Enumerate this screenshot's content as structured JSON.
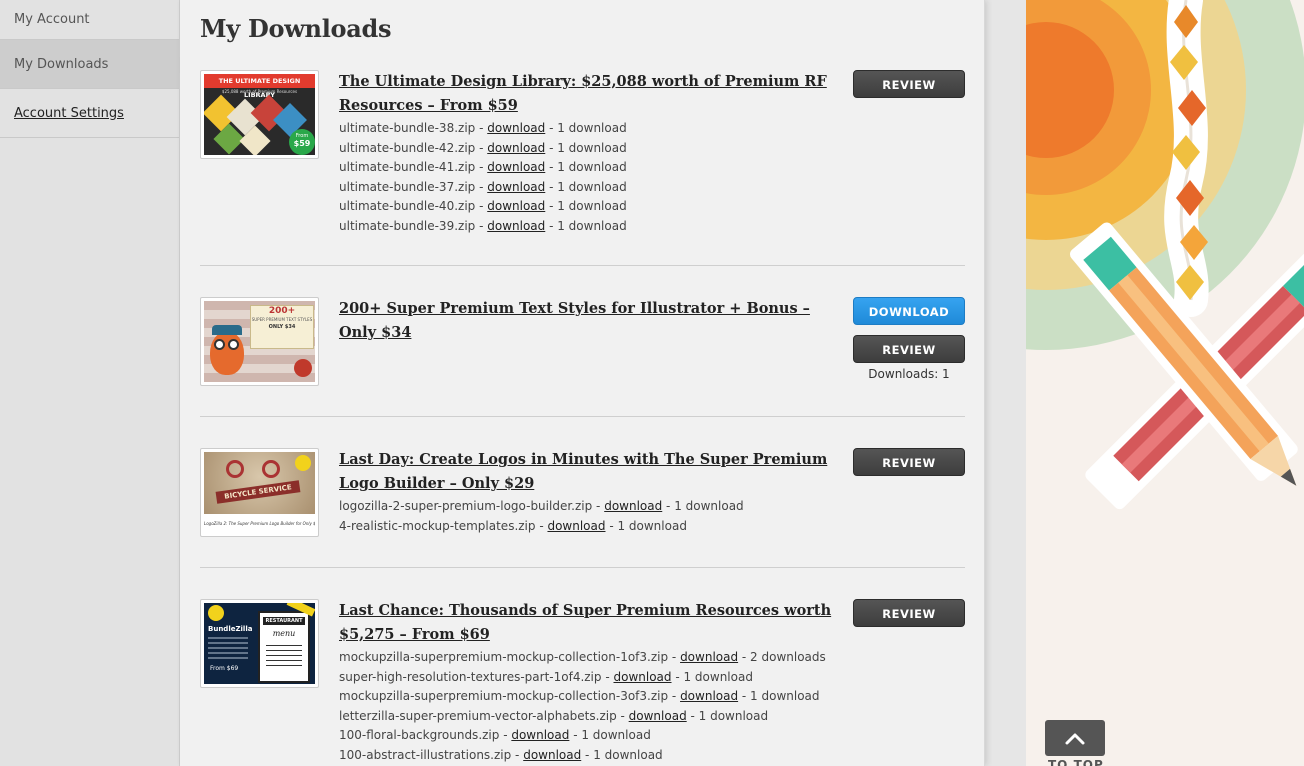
{
  "sidebar": {
    "items": [
      {
        "label": "My Account"
      },
      {
        "label": "My Downloads"
      },
      {
        "label": "Account Settings"
      }
    ]
  },
  "page": {
    "title": "My Downloads"
  },
  "buttons": {
    "review": "REVIEW",
    "download": "DOWNLOAD"
  },
  "download_link": "download",
  "products": [
    {
      "title": "The Ultimate Design Library: $25,088 worth of Premium RF Resources – From $59",
      "files": [
        {
          "name": "ultimate-bundle-38.zip - ",
          "count": " - 1 download"
        },
        {
          "name": "ultimate-bundle-42.zip - ",
          "count": " - 1 download"
        },
        {
          "name": "ultimate-bundle-41.zip - ",
          "count": " - 1 download"
        },
        {
          "name": "ultimate-bundle-37.zip - ",
          "count": " - 1 download"
        },
        {
          "name": "ultimate-bundle-40.zip - ",
          "count": " - 1 download"
        },
        {
          "name": "ultimate-bundle-39.zip - ",
          "count": " - 1 download"
        }
      ],
      "thumb": {
        "line1": "THE ULTIMATE DESIGN LIBRARY",
        "line2": "$25,088 worth of Premium Resources",
        "price1": "From",
        "price2": "$59"
      }
    },
    {
      "title": "200+ Super Premium Text Styles for Illustrator + Bonus – Only $34",
      "downloads_label": "Downloads: 1",
      "thumb": {
        "line1": "200+",
        "line2": "SUPER PREMIUM TEXT STYLES",
        "line3": "ONLY $34"
      }
    },
    {
      "title": "Last Day: Create Logos in Minutes with The Super Premium Logo Builder – Only $29",
      "files": [
        {
          "name": "logozilla-2-super-premium-logo-builder.zip - ",
          "count": " - 1 download"
        },
        {
          "name": "4-realistic-mockup-templates.zip - ",
          "count": " - 1 download"
        }
      ],
      "thumb": {
        "line1": "BICYCLE SERVICE",
        "line2": "LogoZilla 2: The Super Premium Logo Builder for Only $29"
      }
    },
    {
      "title": "Last Chance: Thousands of Super Premium Resources worth $5,275 – From $69",
      "files": [
        {
          "name": "mockupzilla-superpremium-mockup-collection-1of3.zip - ",
          "count": " - 2 downloads"
        },
        {
          "name": "super-high-resolution-textures-part-1of4.zip - ",
          "count": " - 1 download"
        },
        {
          "name": "mockupzilla-superpremium-mockup-collection-3of3.zip - ",
          "count": " - 1 download"
        },
        {
          "name": "letterzilla-super-premium-vector-alphabets.zip - ",
          "count": " - 1 download"
        },
        {
          "name": "100-floral-backgrounds.zip - ",
          "count": " - 1 download"
        },
        {
          "name": "100-abstract-illustrations.zip - ",
          "count": " - 1 download"
        }
      ],
      "thumb": {
        "line1": "BundleZilla",
        "line2": "From $69",
        "line3": "RESTAURANT",
        "line4": "menu"
      }
    }
  ],
  "to_top": "TO TOP",
  "colors": {
    "accent_blue": "#1f8ad8",
    "dark_button": "#444444",
    "deco_orange": "#f07a2a"
  }
}
